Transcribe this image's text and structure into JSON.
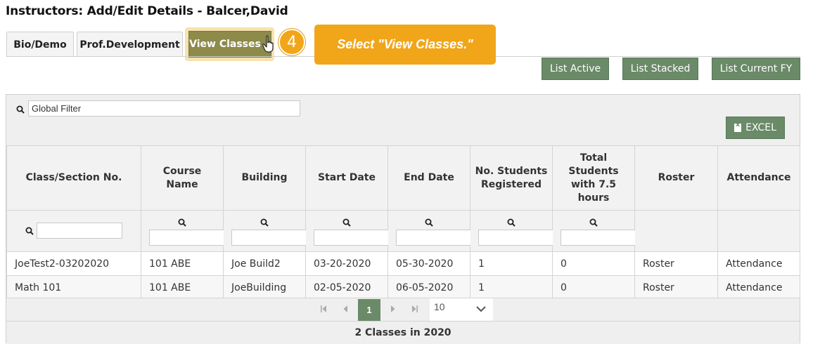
{
  "page": {
    "title": "Instructors: Add/Edit Details - Balcer,David"
  },
  "tabs": [
    {
      "label": "Bio/Demo"
    },
    {
      "label": "Prof.Development"
    },
    {
      "label": "View Classes"
    }
  ],
  "tutorial": {
    "step": "4",
    "callout": "Select \"View Classes.\""
  },
  "actions": {
    "list_active": "List Active",
    "list_stacked": "List Stacked",
    "list_current_fy": "List Current FY"
  },
  "grid": {
    "global_filter_placeholder": "Global Filter",
    "excel_label": "EXCEL",
    "columns": [
      "Class/Section No.",
      "Course Name",
      "Building",
      "Start Date",
      "End Date",
      "No. Students Registered",
      "Total Students with 7.5 hours",
      "Roster",
      "Attendance"
    ],
    "rows": [
      {
        "class_section": "JoeTest2-03202020",
        "course": "101 ABE",
        "building": "Joe Build2",
        "start": "03-20-2020",
        "end": "05-30-2020",
        "registered": "1",
        "total_7_5": "0",
        "roster": "Roster",
        "attendance": "Attendance"
      },
      {
        "class_section": "Math 101",
        "course": "101 ABE",
        "building": "JoeBuilding",
        "start": "02-05-2020",
        "end": "06-05-2020",
        "registered": "1",
        "total_7_5": "0",
        "roster": "Roster",
        "attendance": "Attendance"
      }
    ],
    "pager": {
      "current_page": "1",
      "page_size": "10"
    },
    "summary": "2 Classes in 2020"
  },
  "colors": {
    "accent_green": "#6a8a68",
    "active_tab": "#8d8a4a",
    "tutorial_orange": "#f1a619",
    "link": "#2a6db5"
  }
}
